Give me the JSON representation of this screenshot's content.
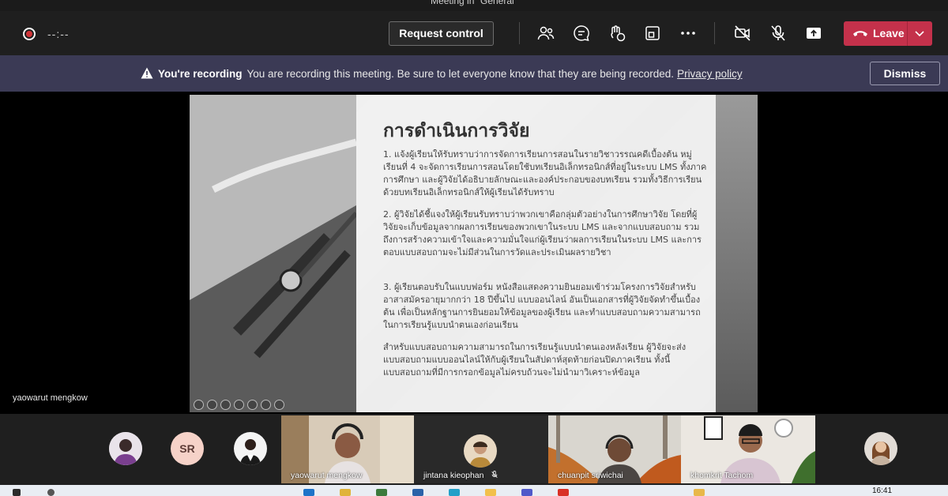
{
  "window": {
    "title": "Meeting in \"General\""
  },
  "toolbar": {
    "timer": "--:--",
    "request_control_label": "Request control",
    "icons": [
      "people-icon",
      "chat-icon",
      "reactions-icon",
      "rooms-icon",
      "more-icon",
      "camera-off-icon",
      "mic-off-icon",
      "share-icon"
    ],
    "leave_label": "Leave",
    "leave_color": "#c4314b"
  },
  "banner": {
    "title": "You're recording",
    "message": "You are recording this meeting. Be sure to let everyone know that they are being recorded.",
    "link": "Privacy policy",
    "dismiss_label": "Dismiss",
    "bg_color": "#3b3a55"
  },
  "slide": {
    "heading": "การดำเนินการวิจัย",
    "p1": "1. แจ้งผู้เรียนให้รับทราบว่าการจัดการเรียนการสอนในรายวิชาวรรณคดีเบื้องต้น หมู่เรียนที่ 4 จะจัดการเรียนการสอนโดยใช้บทเรียนอิเล็กทรอนิกส์ที่อยู่ในระบบ LMS ทั้งภาคการศึกษา และผู้วิจัยได้อธิบายลักษณะและองค์ประกอบของบทเรียน รวมทั้งวิธีการเรียนด้วยบทเรียนอิเล็กทรอนิกส์ให้ผู้เรียนได้รับทราบ",
    "p2": "2. ผู้วิจัยได้ชี้แจงให้ผู้เรียนรับทราบว่าพวกเขาคือกลุ่มตัวอย่างในการศึกษาวิจัย โดยที่ผู้วิจัยจะเก็บข้อมูลจากผลการเรียนของพวกเขาในระบบ LMS และจากแบบสอบถาม รวมถึงการสร้างความเข้าใจและความมั่นใจแก่ผู้เรียนว่าผลการเรียนในระบบ LMS และการตอบแบบสอบถามจะไม่มีส่วนในการวัดและประเมินผลรายวิชา",
    "p3": "3. ผู้เรียนตอบรับในแบบฟอร์ม หนังสือแสดงความยินยอมเข้าร่วมโครงการวิจัยสำหรับอาสาสมัครอายุมากกว่า 18 ปีขึ้นไป แบบออนไลน์ อันเป็นเอกสารที่ผู้วิจัยจัดทำขึ้นเบื้องต้น เพื่อเป็นหลักฐานการยินยอมให้ข้อมูลของผู้เรียน และทำแบบสอบถามความสามารถในการเรียนรู้แบบนำตนเองก่อนเรียน",
    "p4": "สำหรับแบบสอบถามความสามารถในการเรียนรู้แบบนำตนเองหลังเรียน ผู้วิจัยจะส่งแบบสอบถามแบบออนไลน์ให้กับผู้เรียนในสัปดาห์สุดท้ายก่อนปิดภาคเรียน ทั้งนี้แบบสอบถามที่มีการกรอกข้อมูลไม่ครบถ้วนจะไม่นำมาวิเคราะห์ข้อมูล"
  },
  "presenter": {
    "name": "yaowarut mengkow"
  },
  "participants": {
    "sr_initials": "SR",
    "sr_color": "#f6d2c8",
    "tile1": "yaowarut mengkow",
    "tile2": "jintana kieophan",
    "tile3": "chuanpit sriwichai",
    "tile4": "khomkrit Tachom"
  },
  "taskbar": {
    "time": "16:41"
  }
}
